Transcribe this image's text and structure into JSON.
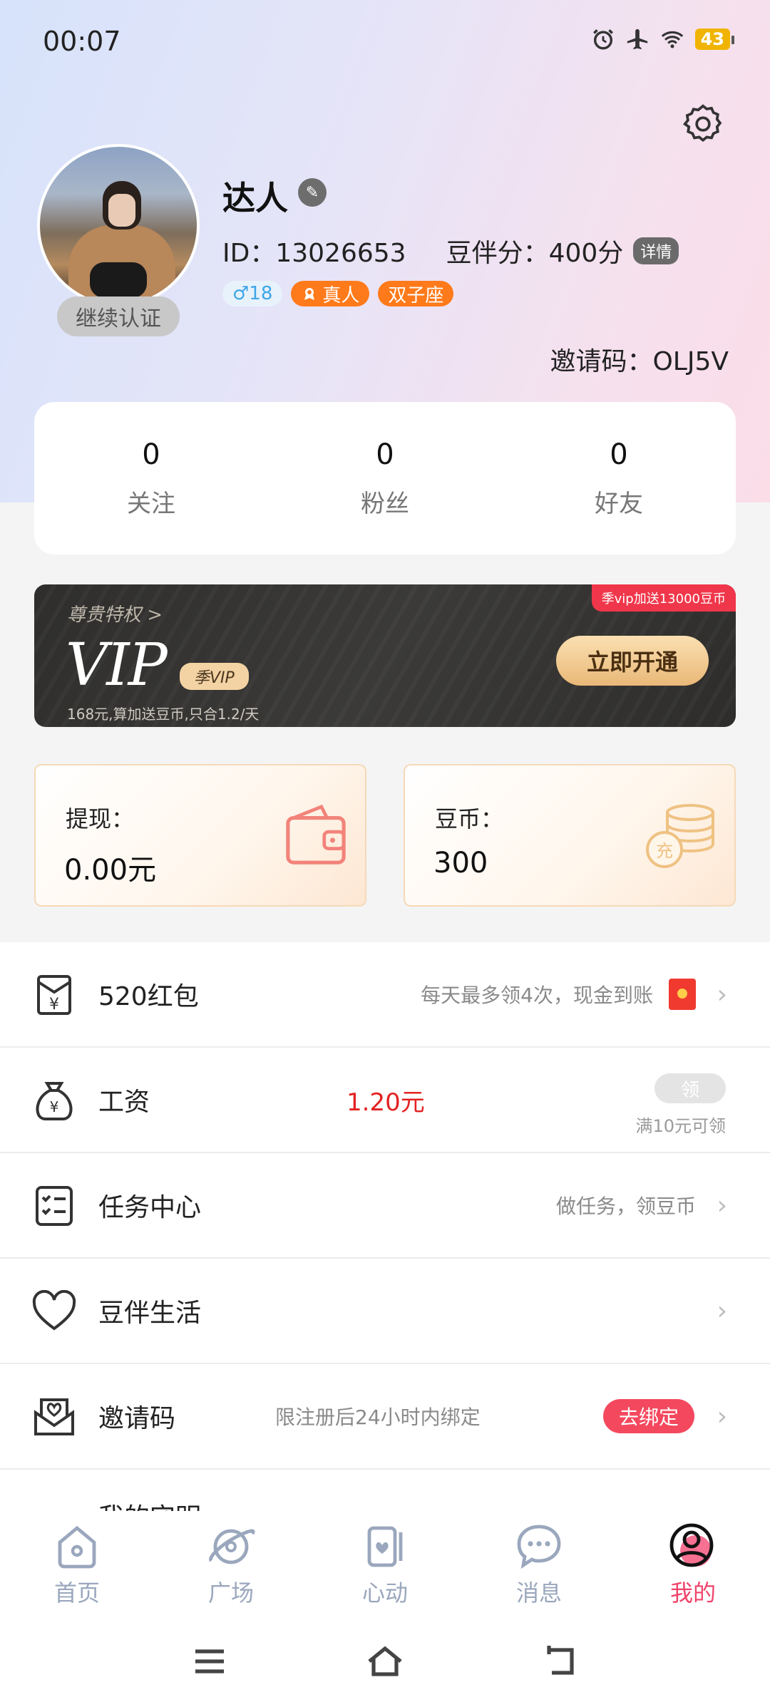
{
  "status_bar": {
    "time": "00:07",
    "battery": "43"
  },
  "profile": {
    "name": "达人",
    "id_text": "ID：13026653",
    "score_text": "豆伴分：400分",
    "detail_label": "详情",
    "verify_label": "继续认证",
    "tags": {
      "gender_age": "♂18",
      "real": "真人",
      "zodiac": "双子座"
    },
    "invite_code": "邀请码：OLJ5V"
  },
  "stats": [
    {
      "value": "0",
      "label": "关注"
    },
    {
      "value": "0",
      "label": "粉丝"
    },
    {
      "value": "0",
      "label": "好友"
    }
  ],
  "vip": {
    "privilege": "尊贵特权 >",
    "title": "VIP",
    "season_badge": "季VIP",
    "description": "168元,算加送豆币,只合1.2/天",
    "promo": "季vip加送13000豆币",
    "open_label": "立即开通"
  },
  "wallet": {
    "withdraw_label": "提现：",
    "withdraw_value": "0.00元",
    "coins_label": "豆币：",
    "coins_value": "300",
    "recharge_icon_text": "充"
  },
  "menu": {
    "redpacket": {
      "title": "520红包",
      "hint": "每天最多领4次，现金到账"
    },
    "salary": {
      "title": "工资",
      "value": "1.20元",
      "claim": "领",
      "claim_note": "满10元可领"
    },
    "tasks": {
      "title": "任务中心",
      "hint": "做任务，领豆币"
    },
    "life": {
      "title": "豆伴生活"
    },
    "invite": {
      "title": "邀请码",
      "hint": "限注册后24小时内绑定",
      "bind": "去绑定"
    },
    "partial": {
      "title": "我的守明"
    }
  },
  "tabbar": [
    {
      "label": "首页",
      "icon": "home-icon"
    },
    {
      "label": "广场",
      "icon": "planet-icon"
    },
    {
      "label": "心动",
      "icon": "cards-heart-icon"
    },
    {
      "label": "消息",
      "icon": "chat-icon"
    },
    {
      "label": "我的",
      "icon": "profile-icon",
      "active": true
    }
  ],
  "colors": {
    "accent": "#f0436a",
    "orange": "#ff7a1a",
    "red": "#e32222"
  }
}
